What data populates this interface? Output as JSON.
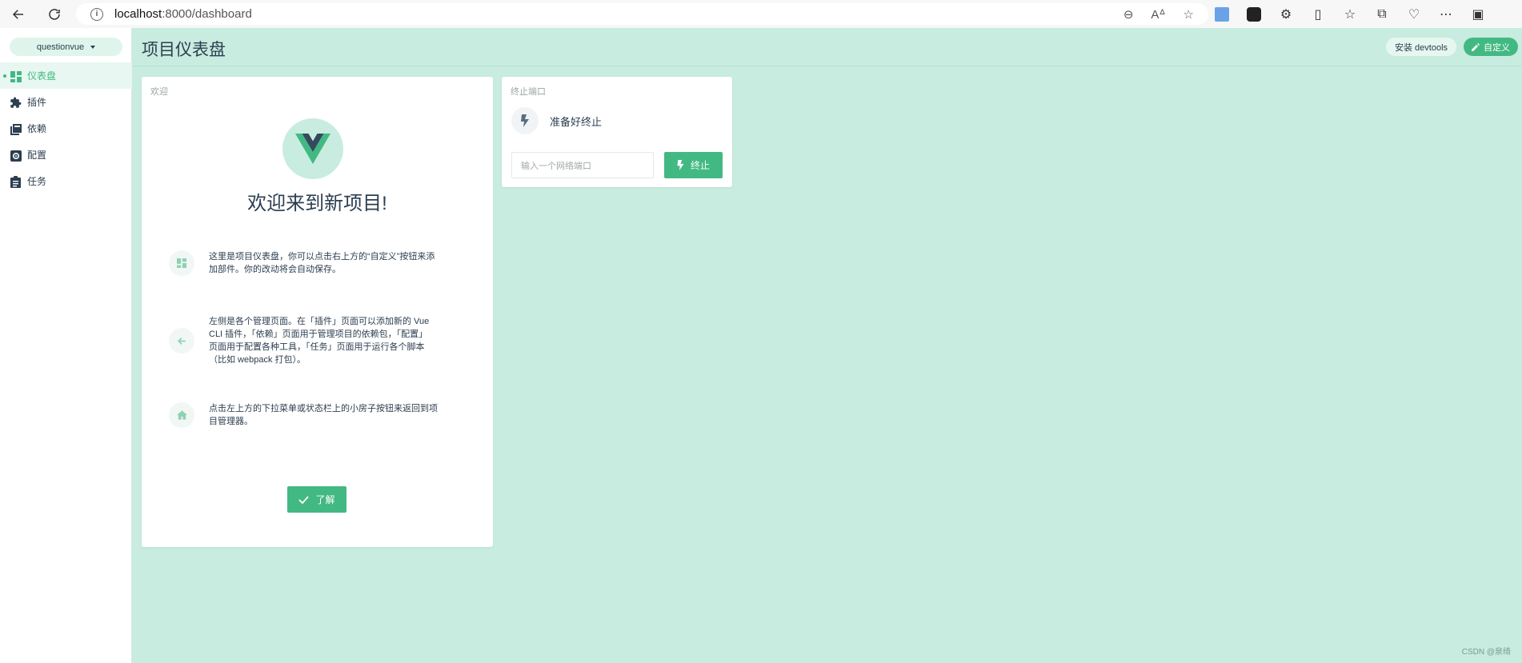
{
  "browser": {
    "url_host": "localhost",
    "url_path": ":8000/dashboard"
  },
  "sidebar": {
    "project_name": "questionvue",
    "items": [
      {
        "label": "仪表盘"
      },
      {
        "label": "插件"
      },
      {
        "label": "依赖"
      },
      {
        "label": "配置"
      },
      {
        "label": "任务"
      }
    ]
  },
  "header": {
    "title": "项目仪表盘",
    "devtools_label": "安装 devtools",
    "customize_label": "自定义"
  },
  "welcome": {
    "card_title": "欢迎",
    "heading": "欢迎来到新项目!",
    "tips": [
      {
        "line1": "这里是项目仪表盘，你可以点击右上方的“自定义”按钮来添",
        "line2": "加部件。你的改动将会自动保存。"
      },
      {
        "line1": "左侧是各个管理页面。在「插件」页面可以添加新的 Vue",
        "line2": "CLI 插件，「依赖」页面用于管理项目的依赖包，「配置」",
        "line3": "页面用于配置各种工具，「任务」页面用于运行各个脚本",
        "line4": "（比如 webpack 打包）。"
      },
      {
        "line1": "点击左上方的下拉菜单或状态栏上的小房子按钮来返回到项",
        "line2": "目管理器。"
      }
    ],
    "ok_label": "了解"
  },
  "kill_port": {
    "card_title": "终止端口",
    "status": "准备好终止",
    "input_placeholder": "输入一个网络端口",
    "button_label": "终止"
  },
  "watermark": "CSDN @泉绮",
  "colors": {
    "accent": "#42b983",
    "background": "#c8ecdf",
    "vue_dark": "#35495e"
  }
}
